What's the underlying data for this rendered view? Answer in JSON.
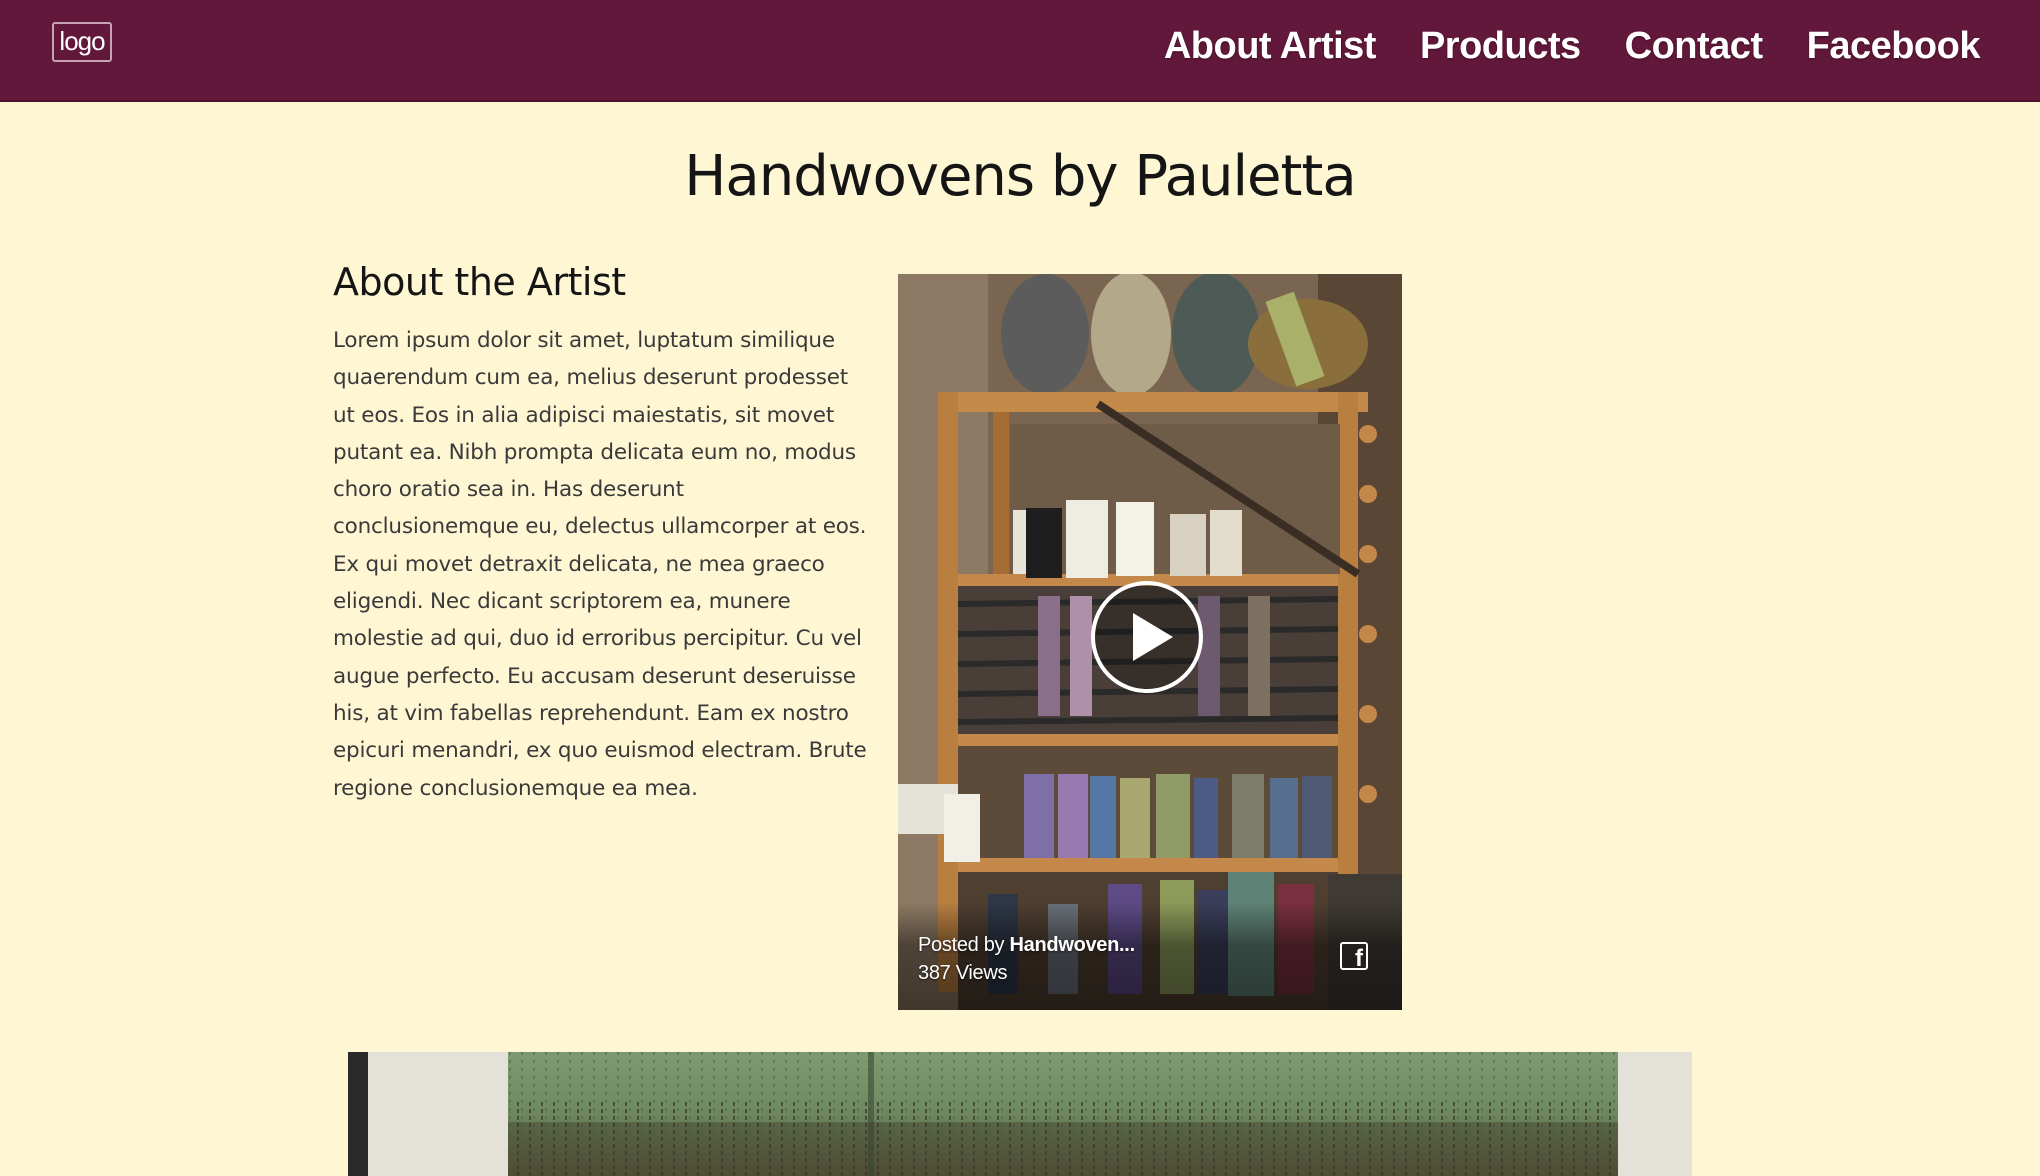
{
  "header": {
    "logo_text": "logo",
    "nav": [
      {
        "label": "About Artist"
      },
      {
        "label": "Products"
      },
      {
        "label": "Contact"
      },
      {
        "label": "Facebook"
      }
    ],
    "background_color": "#62183a"
  },
  "page": {
    "title": "Handwovens by Pauletta",
    "background_color": "#fff7d4"
  },
  "about": {
    "heading": "About the Artist",
    "body": "Lorem ipsum dolor sit amet, luptatum similique quaerendum cum ea, melius deserunt prodesset ut eos. Eos in alia adipisci maiestatis, sit movet putant ea. Nibh prompta delicata eum no, modus choro oratio sea in. Has deserunt conclusionemque eu, delectus ullamcorper at eos. Ex qui movet detraxit delicata, ne mea graeco eligendi. Nec dicant scriptorem ea, munere molestie ad qui, duo id erroribus percipitur. Cu vel augue perfecto. Eu accusam deserunt deseruisse his, at vim fabellas reprehendunt. Eam ex nostro epicuri menandri, ex quo euismod electram. Brute regione conclusionemque ea mea."
  },
  "video": {
    "posted_prefix": "Posted by ",
    "poster": "Handwoven...",
    "views": "387 Views",
    "icons": {
      "play": "play-icon",
      "platform": "facebook-icon"
    }
  },
  "gallery": {
    "image": "woven-textile-photo"
  }
}
